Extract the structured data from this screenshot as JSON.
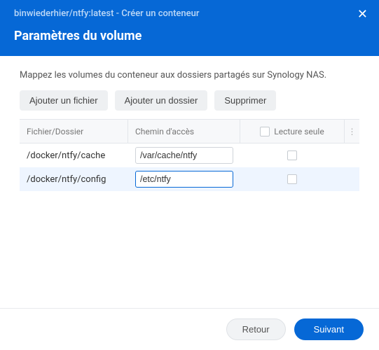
{
  "header": {
    "title": "binwiederhier/ntfy:latest - Créer un conteneur",
    "subtitle": "Paramètres du volume"
  },
  "description": "Mappez les volumes du conteneur aux dossiers partagés sur Synology NAS.",
  "toolbar": {
    "add_file": "Ajouter un fichier",
    "add_folder": "Ajouter un dossier",
    "delete": "Supprimer"
  },
  "columns": {
    "file_folder": "Fichier/Dossier",
    "path": "Chemin d'accès",
    "readonly": "Lecture seule"
  },
  "rows": [
    {
      "file": "/docker/ntfy/cache",
      "path": "/var/cache/ntfy",
      "readonly": false,
      "selected": false
    },
    {
      "file": "/docker/ntfy/config",
      "path": "/etc/ntfy",
      "readonly": false,
      "selected": true
    }
  ],
  "footer": {
    "back": "Retour",
    "next": "Suivant"
  }
}
